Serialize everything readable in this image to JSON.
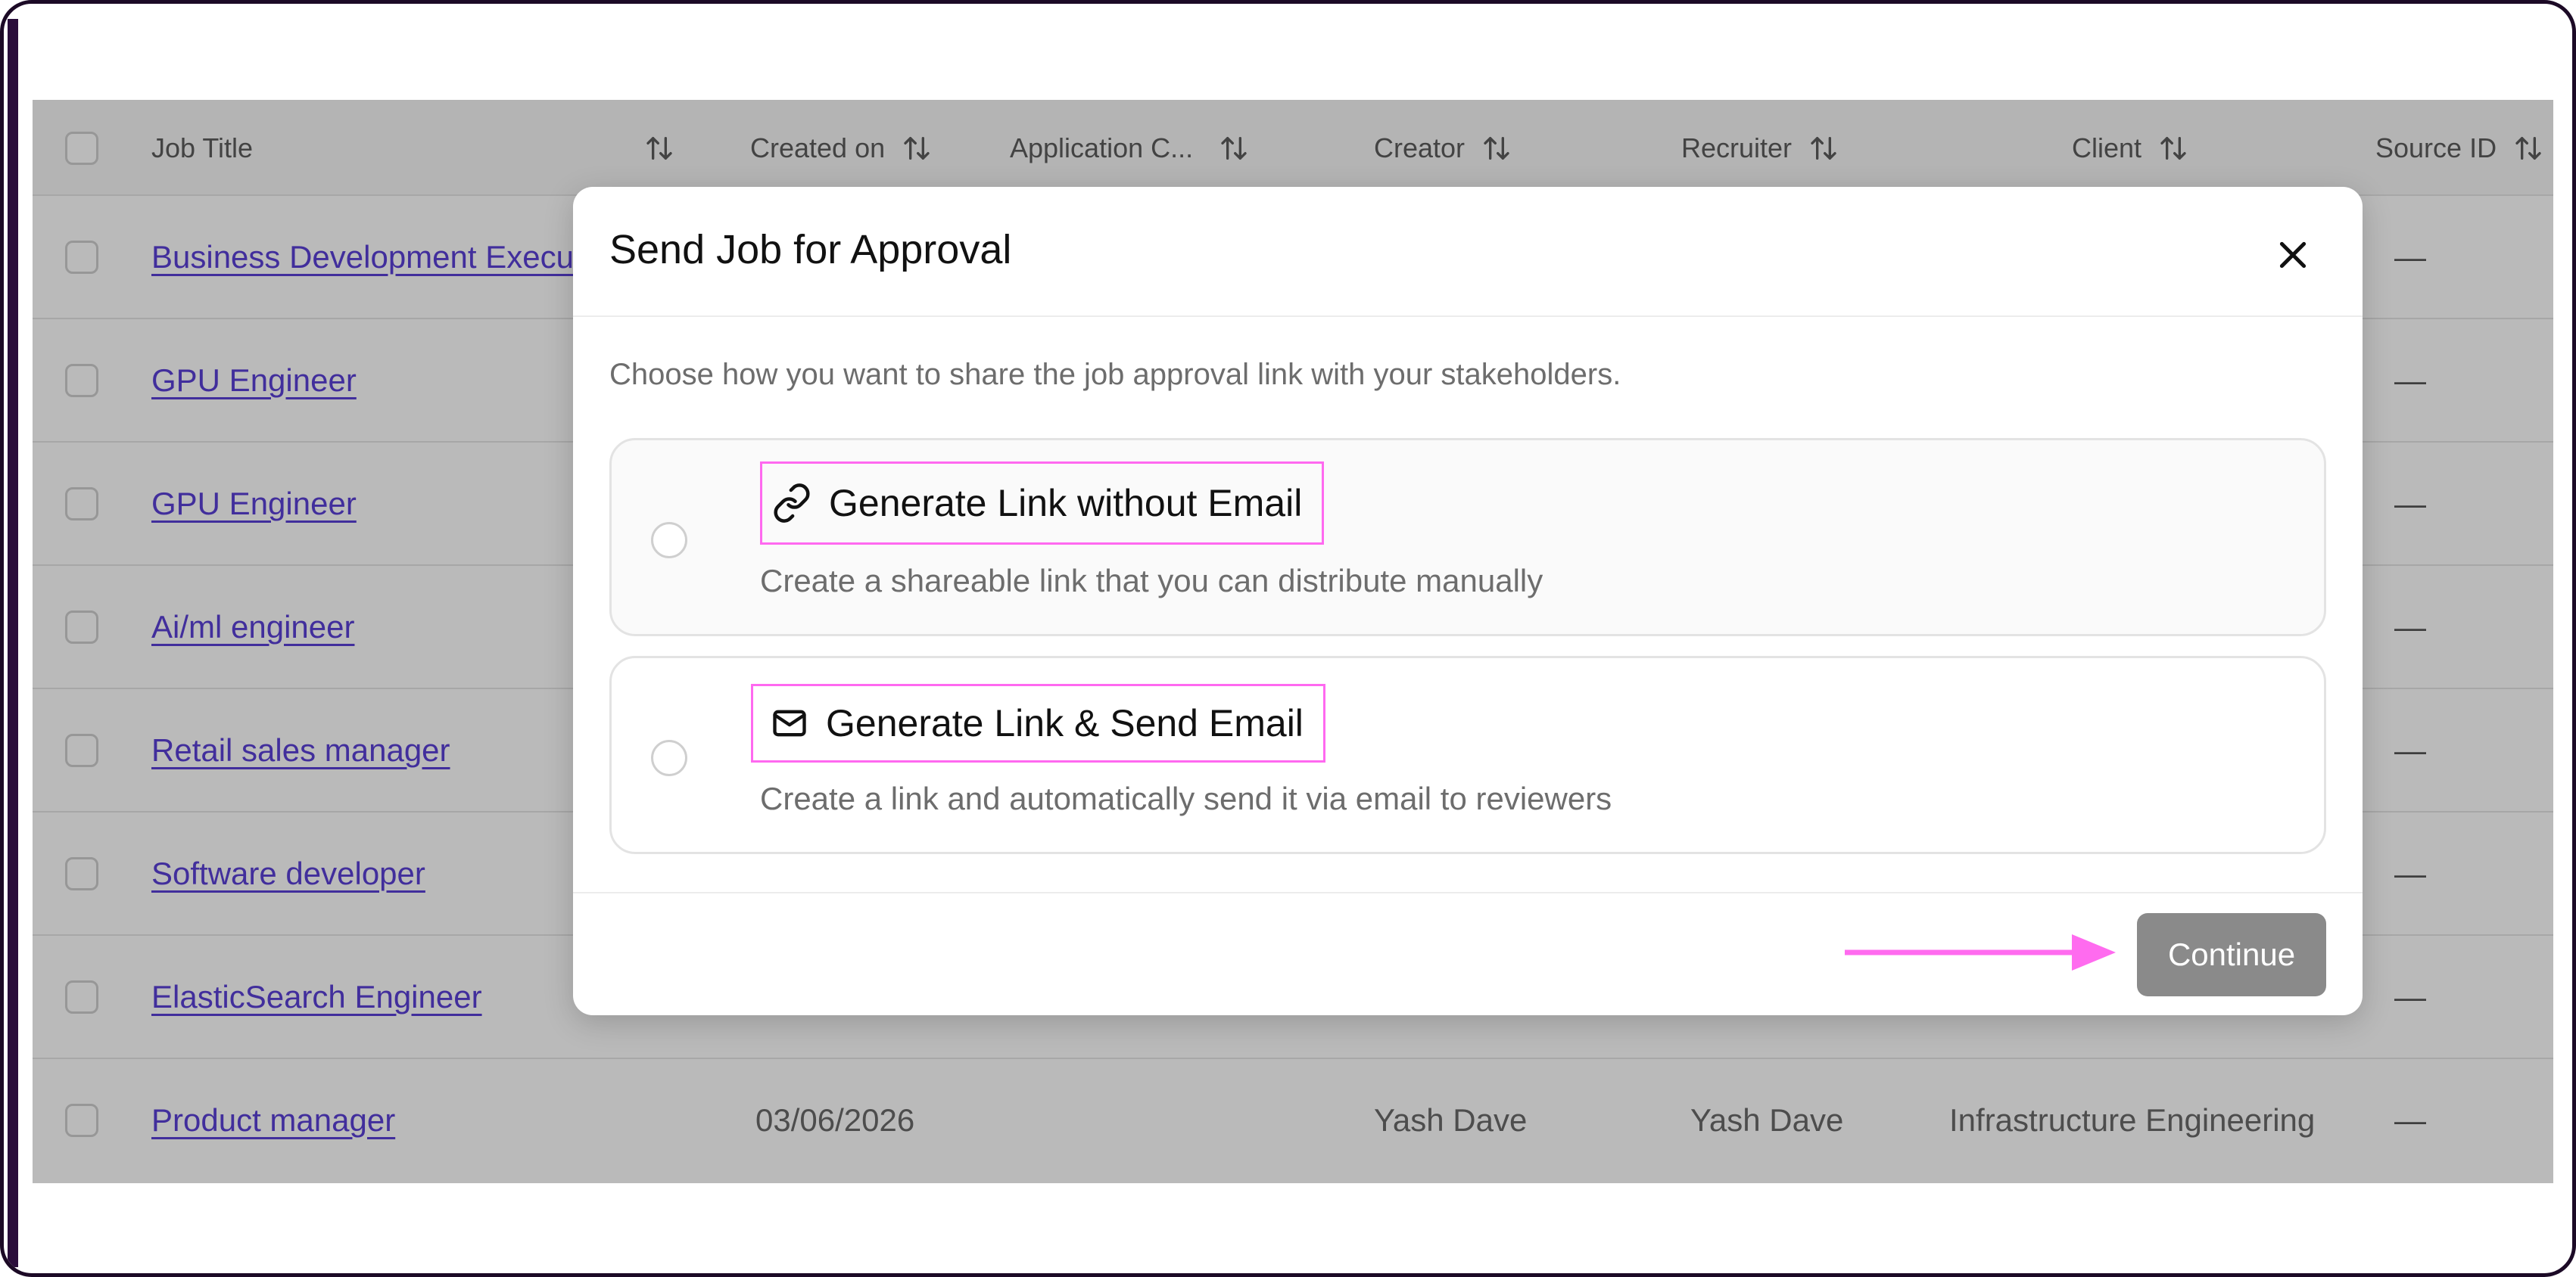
{
  "table": {
    "columns": [
      {
        "label": "Job Title"
      },
      {
        "label": "Created on"
      },
      {
        "label": "Application C..."
      },
      {
        "label": "Creator"
      },
      {
        "label": "Recruiter"
      },
      {
        "label": "Client"
      },
      {
        "label": "Source ID"
      }
    ],
    "rows": [
      {
        "title": "Business Development Execu",
        "created": "",
        "creator": "",
        "recruiter": "",
        "client": "",
        "source": "—"
      },
      {
        "title": "GPU Engineer",
        "created": "",
        "creator": "",
        "recruiter": "",
        "client": "",
        "source": "—"
      },
      {
        "title": "GPU Engineer",
        "created": "",
        "creator": "",
        "recruiter": "",
        "client": "",
        "source": "—"
      },
      {
        "title": "Ai/ml engineer",
        "created": "",
        "creator": "",
        "recruiter": "",
        "client": "",
        "source": "—"
      },
      {
        "title": "Retail sales manager",
        "created": "",
        "creator": "",
        "recruiter": "",
        "client": "",
        "source": "—"
      },
      {
        "title": "Software developer",
        "created": "",
        "creator": "",
        "recruiter": "",
        "client": "",
        "source": "—"
      },
      {
        "title": "ElasticSearch Engineer",
        "created": "",
        "creator": "",
        "recruiter": "",
        "client": "",
        "source": "—"
      },
      {
        "title": "Product manager",
        "created": "03/06/2026",
        "creator": "Yash Dave",
        "recruiter": "Yash Dave",
        "client": "Infrastructure Engineering",
        "source": "—"
      }
    ]
  },
  "modal": {
    "title": "Send Job for Approval",
    "description": "Choose how you want to share the job approval link with your stakeholders.",
    "options": [
      {
        "title": "Generate Link without Email",
        "subtitle": "Create a shareable link that you can distribute manually",
        "icon": "link-icon"
      },
      {
        "title": "Generate Link & Send Email",
        "subtitle": "Create a link and automatically send it via email to reviewers",
        "icon": "mail-icon"
      }
    ],
    "continue_label": "Continue"
  },
  "colors": {
    "link": "#5a3fd6",
    "highlight": "#ff69f0",
    "button_disabled": "#8a8a8a"
  }
}
